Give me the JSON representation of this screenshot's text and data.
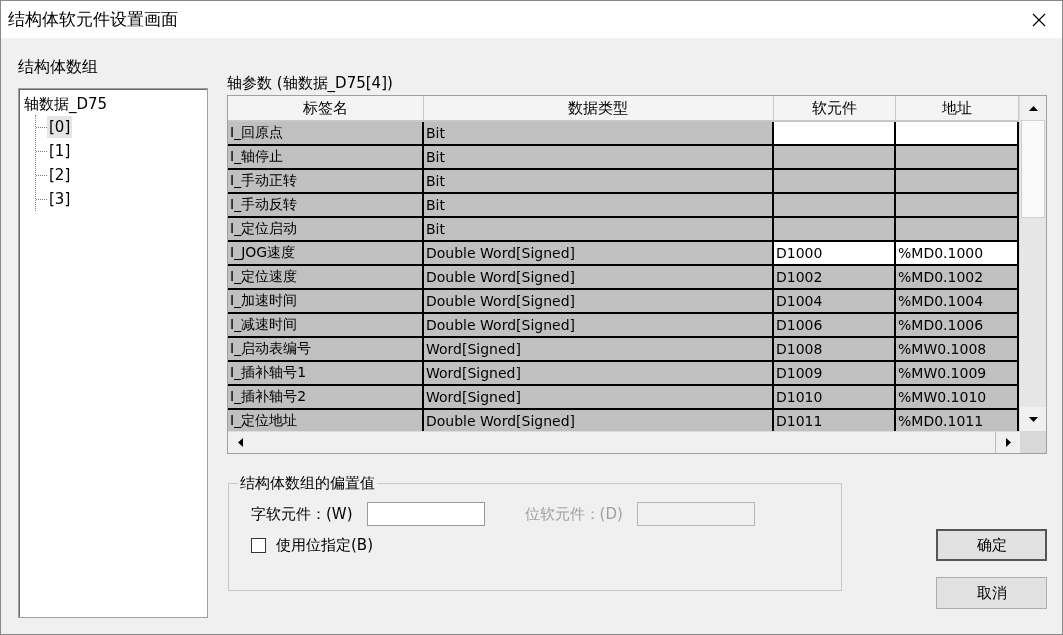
{
  "window": {
    "title": "结构体软元件设置画面"
  },
  "tree": {
    "label": "结构体数组",
    "root": {
      "label": "轴数据_D75",
      "children": [
        {
          "label": "[0]",
          "selected": true
        },
        {
          "label": "[1]",
          "selected": false
        },
        {
          "label": "[2]",
          "selected": false
        },
        {
          "label": "[3]",
          "selected": false
        }
      ]
    }
  },
  "grid": {
    "label": "轴参数 (轴数据_D75[4])",
    "columns": [
      "标签名",
      "数据类型",
      "软元件",
      "地址"
    ],
    "rows": [
      {
        "tag": "I_回原点",
        "type": "Bit",
        "highlighted": true
      },
      {
        "tag": "I_轴停止",
        "type": "Bit",
        "highlighted": false
      },
      {
        "tag": "I_手动正转",
        "type": "Bit",
        "highlighted": false
      },
      {
        "tag": "I_手动反转",
        "type": "Bit",
        "highlighted": false
      },
      {
        "tag": "I_定位启动",
        "type": "Bit",
        "highlighted": false
      },
      {
        "tag": "I_JOG速度",
        "type": "Double Word[Signed]",
        "device": "D1000",
        "address": "%MD0.1000",
        "highlighted": true
      },
      {
        "tag": "I_定位速度",
        "type": "Double Word[Signed]",
        "device": "D1002",
        "address": "%MD0.1002",
        "highlighted": false
      },
      {
        "tag": "I_加速时间",
        "type": "Double Word[Signed]",
        "device": "D1004",
        "address": "%MD0.1004",
        "highlighted": false
      },
      {
        "tag": "I_减速时间",
        "type": "Double Word[Signed]",
        "device": "D1006",
        "address": "%MD0.1006",
        "highlighted": false
      },
      {
        "tag": "I_启动表编号",
        "type": "Word[Signed]",
        "device": "D1008",
        "address": "%MW0.1008",
        "highlighted": false
      },
      {
        "tag": "I_插补轴号1",
        "type": "Word[Signed]",
        "device": "D1009",
        "address": "%MW0.1009",
        "highlighted": false
      },
      {
        "tag": "I_插补轴号2",
        "type": "Word[Signed]",
        "device": "D1010",
        "address": "%MW0.1010",
        "highlighted": false
      },
      {
        "tag": "I_定位地址",
        "type": "Double Word[Signed]",
        "device": "D1011",
        "address": "%MD0.1011",
        "highlighted": false
      }
    ]
  },
  "offset": {
    "title": "结构体数组的偏置值",
    "fields": [
      {
        "label": "字软元件：(W)",
        "disabled": false
      },
      {
        "label": "位软元件：(D)",
        "disabled": true
      }
    ],
    "checkbox": {
      "label": "使用位指定(B)",
      "checked": false
    }
  },
  "buttons": [
    "确定",
    "取消"
  ]
}
